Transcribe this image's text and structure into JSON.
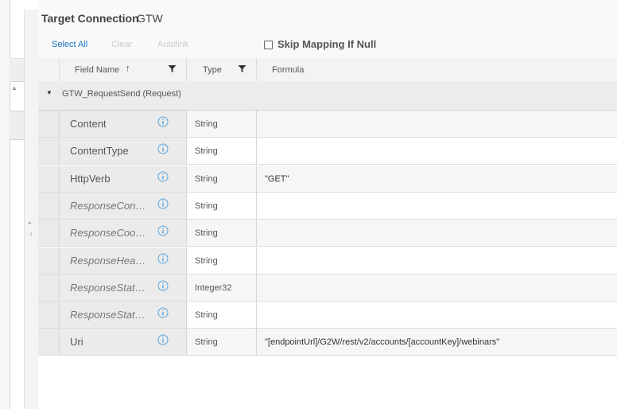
{
  "header": {
    "title_label": "Target Connection",
    "title_value": "GTW"
  },
  "toolbar": {
    "select_all": "Select All",
    "clear": "Clear",
    "autolink": "Autolink",
    "skip_mapping_label": "Skip Mapping If Null",
    "skip_mapping_checked": false
  },
  "columns": {
    "field_name": "Field Name",
    "type": "Type",
    "formula": "Formula"
  },
  "group": {
    "label": "GTW_RequestSend (Request)"
  },
  "rows": [
    {
      "name": "Content",
      "type": "String",
      "formula": "",
      "italic": false
    },
    {
      "name": "ContentType",
      "type": "String",
      "formula": "",
      "italic": false
    },
    {
      "name": "HttpVerb",
      "type": "String",
      "formula": "\"GET\"",
      "italic": false
    },
    {
      "name": "ResponseCont…",
      "type": "String",
      "formula": "",
      "italic": true
    },
    {
      "name": "ResponseCoo…",
      "type": "String",
      "formula": "",
      "italic": true
    },
    {
      "name": "ResponseHea…",
      "type": "String",
      "formula": "",
      "italic": true
    },
    {
      "name": "ResponseStat…",
      "type": "Integer32",
      "formula": "",
      "italic": true
    },
    {
      "name": "ResponseStat…",
      "type": "String",
      "formula": "",
      "italic": true
    },
    {
      "name": "Uri",
      "type": "String",
      "formula": "\"[endpointUrl]/G2W/rest/v2/accounts/[accountKey]/webinars\"",
      "italic": false
    }
  ],
  "colors": {
    "link": "#1a73c6",
    "disabled": "#cccccc",
    "info_icon": "#5aa6de"
  }
}
